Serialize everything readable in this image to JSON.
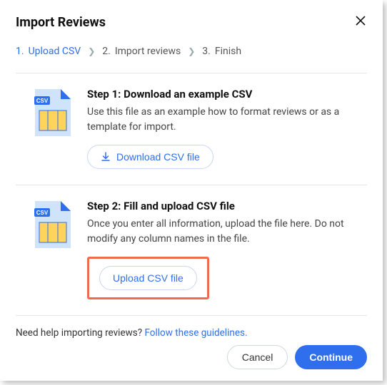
{
  "modal": {
    "title": "Import Reviews",
    "close_aria": "Close"
  },
  "stepper": {
    "steps": [
      {
        "num": "1.",
        "label": "Upload CSV"
      },
      {
        "num": "2.",
        "label": "Import reviews"
      },
      {
        "num": "3.",
        "label": "Finish"
      }
    ]
  },
  "sections": {
    "download": {
      "title": "Step 1: Download an example CSV",
      "desc": "Use this file as an example how to format reviews or as a template for import.",
      "button": "Download CSV file"
    },
    "upload": {
      "title": "Step 2: Fill and upload CSV file",
      "desc": "Once you enter all information, upload the file here. Do not modify any column names in the file.",
      "button": "Upload CSV file"
    }
  },
  "help": {
    "text": "Need help importing reviews? ",
    "link": "Follow these guidelines."
  },
  "footer": {
    "cancel": "Cancel",
    "continue": "Continue"
  }
}
